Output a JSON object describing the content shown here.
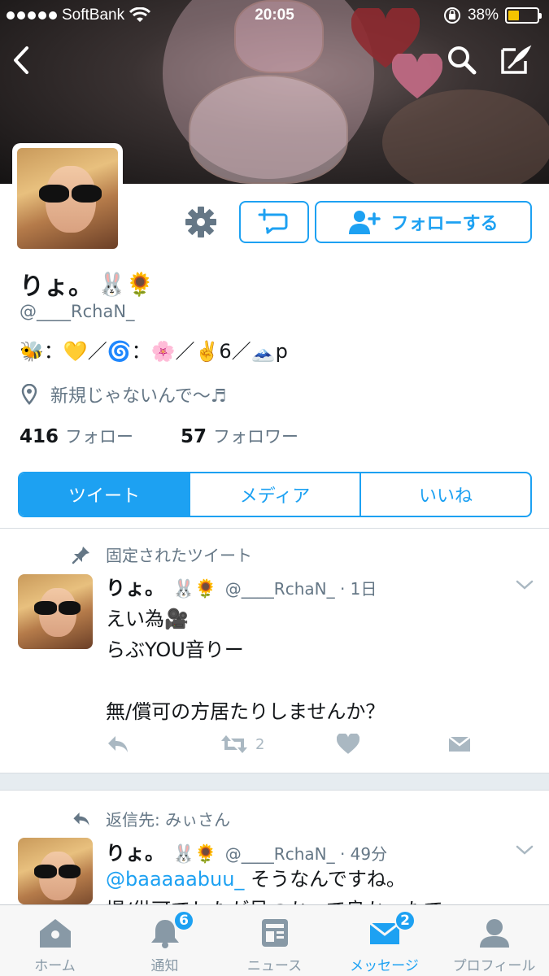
{
  "status_bar": {
    "carrier": "SoftBank",
    "time": "20:05",
    "battery": "38%",
    "battery_level": 0.38
  },
  "profile": {
    "name": "りょ。",
    "name_emoji": "🐰🌻",
    "handle": "@____RchaN_",
    "bio": "🐝：💛／🌀：🌸／✌️6／🗻p",
    "location": "新規じゃないんで〜♬",
    "following_count": "416",
    "following_label": "フォロー",
    "followers_count": "57",
    "followers_label": "フォロワー",
    "follow_button": "フォローする"
  },
  "tabs": [
    {
      "label": "ツイート",
      "active": true
    },
    {
      "label": "メディア",
      "active": false
    },
    {
      "label": "いいね",
      "active": false
    }
  ],
  "tweets": [
    {
      "context": "固定されたツイート",
      "name": "りょ。",
      "name_emoji": "🐰🌻",
      "handle_time": "@____RchaN_ · 1日",
      "lines": [
        "えい為🎥",
        "らぶYOU音りー",
        "",
        "無/償可の方居たりしませんか？"
      ],
      "retweet_count": "2"
    },
    {
      "context": "返信先: みぃさん",
      "name": "りょ。",
      "name_emoji": "🐰🌻",
      "handle_time": "@____RchaN_ · 49分",
      "mention": "@baaaaabuu_",
      "text_after_mention": " そうなんですね。",
      "line2": "提/供可でしたが見つかって良かったで"
    }
  ],
  "tabbar": [
    {
      "label": "ホーム",
      "icon": "home-icon",
      "badge": ""
    },
    {
      "label": "通知",
      "icon": "bell-icon",
      "badge": "6"
    },
    {
      "label": "ニュース",
      "icon": "news-icon",
      "badge": ""
    },
    {
      "label": "メッセージ",
      "icon": "message-icon",
      "badge": "2",
      "active": true
    },
    {
      "label": "プロフィール",
      "icon": "profile-icon",
      "badge": ""
    }
  ],
  "colors": {
    "accent": "#1da1f2",
    "secondary_text": "#657786",
    "icon_gray": "#aab8c2"
  }
}
